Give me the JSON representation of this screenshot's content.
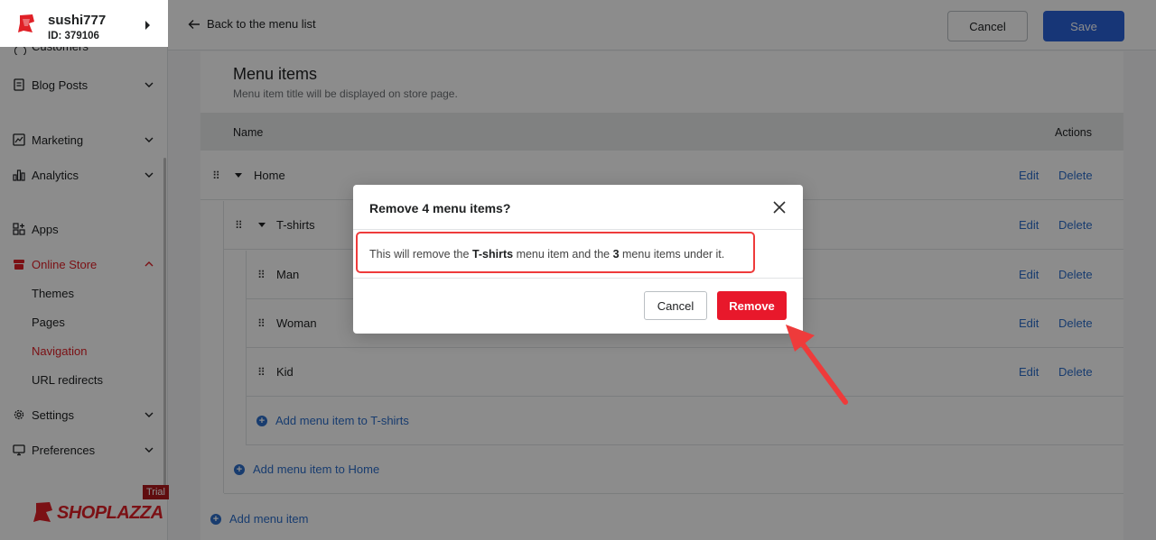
{
  "store": {
    "name": "sushi777",
    "id": "ID: 379106"
  },
  "sidebar": {
    "cut_item": "Customers",
    "items": [
      {
        "label": "Blog Posts",
        "icon": "document-icon"
      },
      {
        "label": "Marketing",
        "icon": "marketing-icon"
      },
      {
        "label": "Analytics",
        "icon": "analytics-icon"
      },
      {
        "label": "Apps",
        "icon": "apps-icon"
      },
      {
        "label": "Online Store",
        "icon": "store-icon"
      },
      {
        "label": "Settings",
        "icon": "gear-icon"
      },
      {
        "label": "Preferences",
        "icon": "monitor-icon"
      }
    ],
    "online_store_sub": [
      "Themes",
      "Pages",
      "Navigation",
      "URL redirects"
    ],
    "brand": "SHOPLAZZA",
    "trial": "Trial"
  },
  "topbar": {
    "back": "Back to the menu list",
    "cancel": "Cancel",
    "save": "Save"
  },
  "menu": {
    "title": "Menu items",
    "subtitle": "Menu item title will be displayed on store page.",
    "col_name": "Name",
    "col_actions": "Actions",
    "edit": "Edit",
    "delete": "Delete",
    "rows": [
      "Home",
      "T-shirts",
      "Man",
      "Woman",
      "Kid"
    ],
    "add_tshirts": "Add menu item to T-shirts",
    "add_home": "Add menu item to Home",
    "add_root": "Add menu item"
  },
  "modal": {
    "title": "Remove 4 menu items?",
    "body_pre": "This will remove the ",
    "body_item": "T-shirts",
    "body_mid": " menu item and the ",
    "body_count": "3",
    "body_post": " menu items under it.",
    "cancel": "Cancel",
    "remove": "Remove"
  },
  "colors": {
    "accent_red": "#e8182b",
    "primary_blue": "#2b63d9",
    "link_blue": "#2c6ecb",
    "annotation_red": "#ee3b3b"
  }
}
